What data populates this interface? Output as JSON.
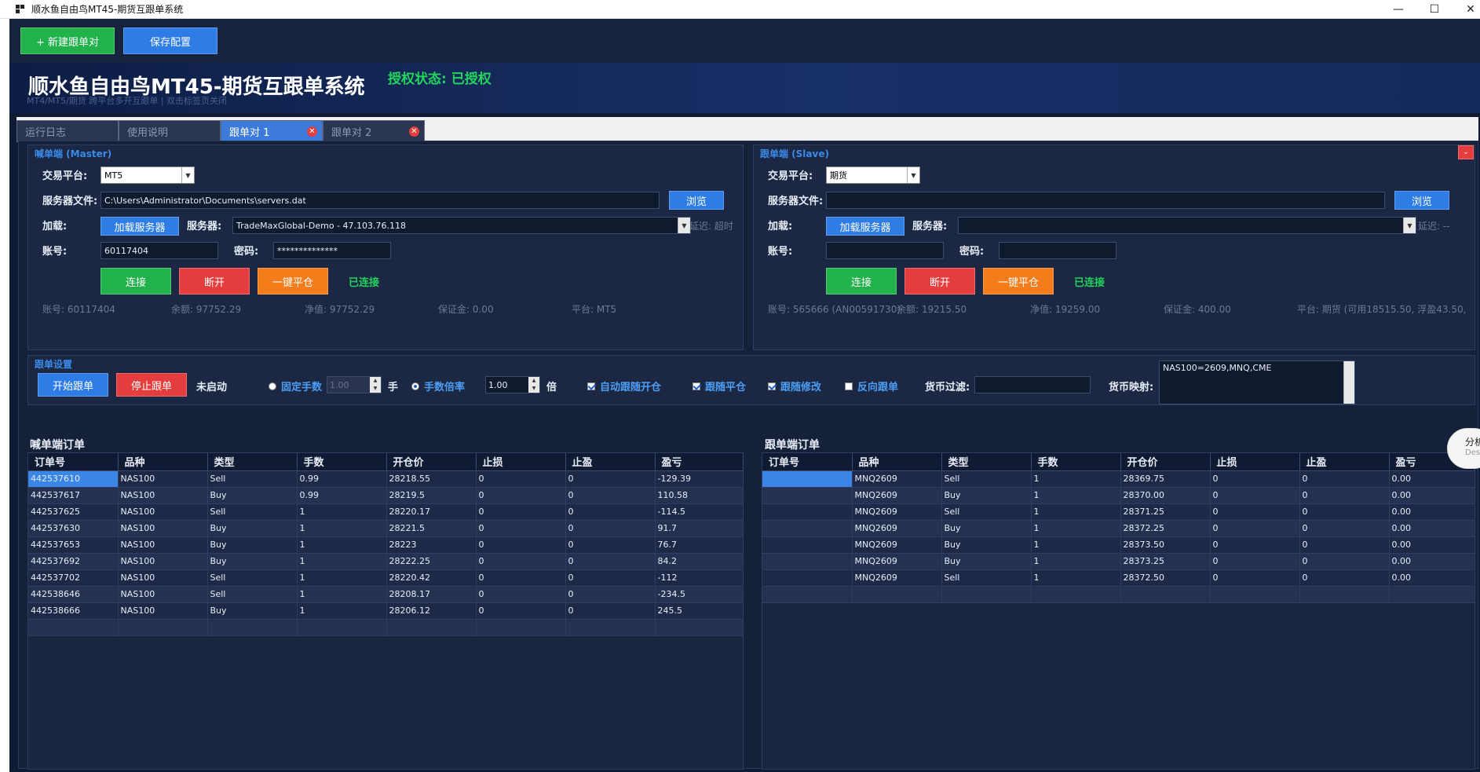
{
  "window": {
    "title": "顺水鱼自由鸟MT45-期货互跟单系统",
    "minimize": "—",
    "maximize": "☐",
    "close": "✕"
  },
  "toolbar": {
    "new_pair": "+ 新建跟单对",
    "save_config": "保存配置"
  },
  "banner": {
    "title": "顺水鱼自由鸟MT45-期货互跟单系统",
    "subtitle": "MT4/MT5/期货 跨平台多开互跟单 | 双击标签页关闭",
    "auth": "授权状态: 已授权"
  },
  "tabs": [
    {
      "label": "运行日志"
    },
    {
      "label": "使用说明"
    },
    {
      "label": "跟单对 1"
    },
    {
      "label": "跟单对 2"
    }
  ],
  "master": {
    "group_label": "喊单端 (Master)",
    "platform_label": "交易平台:",
    "platform_value": "MT5",
    "server_file_label": "服务器文件:",
    "server_file_value": "C:\\Users\\Administrator\\Documents\\servers.dat",
    "browse": "浏览",
    "load_label": "加载:",
    "load_button": "加载服务器",
    "server_label": "服务器:",
    "server_value": "TradeMaxGlobal-Demo - 47.103.76.118",
    "latency": "延迟: 超时",
    "account_label": "账号:",
    "account_value": "60117404",
    "password_label": "密码:",
    "password_value": "**************",
    "connect": "连接",
    "disconnect": "断开",
    "close_all": "一键平仓",
    "status": "已连接",
    "info_account": "账号: 60117404",
    "info_balance": "余额: 97752.29",
    "info_equity": "净值: 97752.29",
    "info_margin": "保证金: 0.00",
    "info_platform": "平台: MT5"
  },
  "slave": {
    "group_label": "跟单端 (Slave)",
    "platform_label": "交易平台:",
    "platform_value": "期货",
    "server_file_label": "服务器文件:",
    "server_file_value": "",
    "browse": "浏览",
    "load_label": "加载:",
    "load_button": "加载服务器",
    "server_label": "服务器:",
    "server_value": "",
    "latency": "延迟: --",
    "account_label": "账号:",
    "account_value": "",
    "password_label": "密码:",
    "password_value": "",
    "connect": "连接",
    "disconnect": "断开",
    "close_all": "一键平仓",
    "status": "已连接",
    "info_account": "账号: 565666 (AN00591730)",
    "info_balance": "余额: 19215.50",
    "info_equity": "净值: 19259.00",
    "info_margin": "保证金: 400.00",
    "info_platform": "平台: 期货 (可用18515.50, 浮盈43.50,"
  },
  "copy_settings": {
    "group_label": "跟单设置",
    "start": "开始跟单",
    "stop": "停止跟单",
    "state": "未启动",
    "fixed_lots": "固定手数",
    "fixed_lots_value": "1.00",
    "lots_unit": "手",
    "lot_multiplier": "手数倍率",
    "lot_multiplier_value": "1.00",
    "multiplier_unit": "倍",
    "auto_follow_open": "自动跟随开仓",
    "follow_close": "跟随平仓",
    "follow_modify": "跟随修改",
    "reverse": "反向跟单",
    "currency_filter_label": "货币过滤:",
    "currency_filter_value": "",
    "currency_map_label": "货币映射:",
    "currency_map_value": "NAS100=2609,MNQ,CME"
  },
  "master_orders": {
    "title": "喊单端订单",
    "columns": [
      "订单号",
      "品种",
      "类型",
      "手数",
      "开仓价",
      "止损",
      "止盈",
      "盈亏"
    ],
    "rows": [
      [
        "442537610",
        "NAS100",
        "Sell",
        "0.99",
        "28218.55",
        "0",
        "0",
        "-129.39"
      ],
      [
        "442537617",
        "NAS100",
        "Buy",
        "0.99",
        "28219.5",
        "0",
        "0",
        "110.58"
      ],
      [
        "442537625",
        "NAS100",
        "Sell",
        "1",
        "28220.17",
        "0",
        "0",
        "-114.5"
      ],
      [
        "442537630",
        "NAS100",
        "Buy",
        "1",
        "28221.5",
        "0",
        "0",
        "91.7"
      ],
      [
        "442537653",
        "NAS100",
        "Buy",
        "1",
        "28223",
        "0",
        "0",
        "76.7"
      ],
      [
        "442537692",
        "NAS100",
        "Buy",
        "1",
        "28222.25",
        "0",
        "0",
        "84.2"
      ],
      [
        "442537702",
        "NAS100",
        "Sell",
        "1",
        "28220.42",
        "0",
        "0",
        "-112"
      ],
      [
        "442538646",
        "NAS100",
        "Sell",
        "1",
        "28208.17",
        "0",
        "0",
        "-234.5"
      ],
      [
        "442538666",
        "NAS100",
        "Buy",
        "1",
        "28206.12",
        "0",
        "0",
        "245.5"
      ],
      [
        "",
        "",
        "",
        "",
        "",
        "",
        "",
        ""
      ]
    ]
  },
  "slave_orders": {
    "title": "跟单端订单",
    "columns": [
      "订单号",
      "品种",
      "类型",
      "手数",
      "开仓价",
      "止损",
      "止盈",
      "盈亏"
    ],
    "rows": [
      [
        "",
        "MNQ2609",
        "Sell",
        "1",
        "28369.75",
        "0",
        "0",
        "0.00"
      ],
      [
        "",
        "MNQ2609",
        "Buy",
        "1",
        "28370.00",
        "0",
        "0",
        "0.00"
      ],
      [
        "",
        "MNQ2609",
        "Sell",
        "1",
        "28371.25",
        "0",
        "0",
        "0.00"
      ],
      [
        "",
        "MNQ2609",
        "Buy",
        "1",
        "28372.25",
        "0",
        "0",
        "0.00"
      ],
      [
        "",
        "MNQ2609",
        "Buy",
        "1",
        "28373.50",
        "0",
        "0",
        "0.00"
      ],
      [
        "",
        "MNQ2609",
        "Buy",
        "1",
        "28373.25",
        "0",
        "0",
        "0.00"
      ],
      [
        "",
        "MNQ2609",
        "Sell",
        "1",
        "28372.50",
        "0",
        "0",
        "0.00"
      ],
      [
        "",
        "",
        "",
        "",
        "",
        "",
        "",
        ""
      ]
    ]
  },
  "side_widget": {
    "label": "分析",
    "sub": "Des"
  }
}
